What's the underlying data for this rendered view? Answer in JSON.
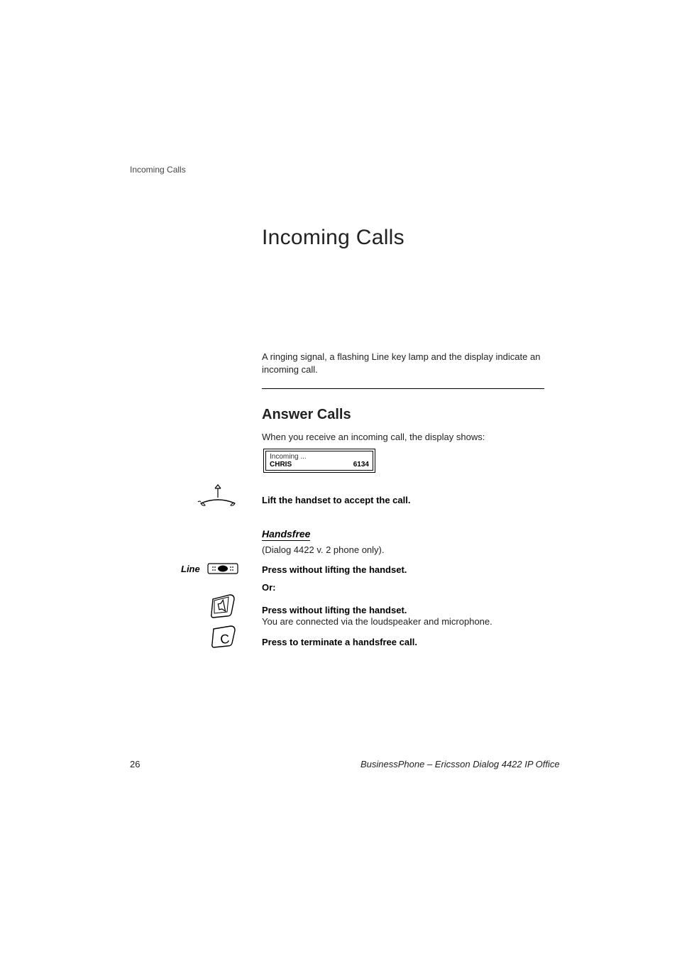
{
  "breadcrumb": "Incoming Calls",
  "title": "Incoming Calls",
  "intro": "A ringing signal, a flashing Line key lamp and the display indicate an incoming call.",
  "section": {
    "heading": "Answer Calls",
    "lead": "When you receive an incoming call, the display shows:",
    "display": {
      "line1": "Incoming ...",
      "name": "CHRIS",
      "number": "6134"
    },
    "lift": "Lift the handset to accept the call.",
    "handsfree": {
      "heading": "Handsfree",
      "note": "(Dialog 4422 v. 2 phone only).",
      "line_label": "Line",
      "press1": "Press without lifting the handset.",
      "or": "Or:",
      "press2": "Press without lifting the handset.",
      "connected": "You are connected via the loudspeaker and microphone.",
      "terminate": "Press to terminate a handsfree call."
    }
  },
  "footer": {
    "page_number": "26",
    "doc_title": "BusinessPhone – Ericsson Dialog 4422 IP Office"
  },
  "icons": {
    "handset": "handset-offhook-icon",
    "line_key": "line-key-icon",
    "speaker": "speaker-key-icon",
    "clear": "clear-key-icon"
  }
}
